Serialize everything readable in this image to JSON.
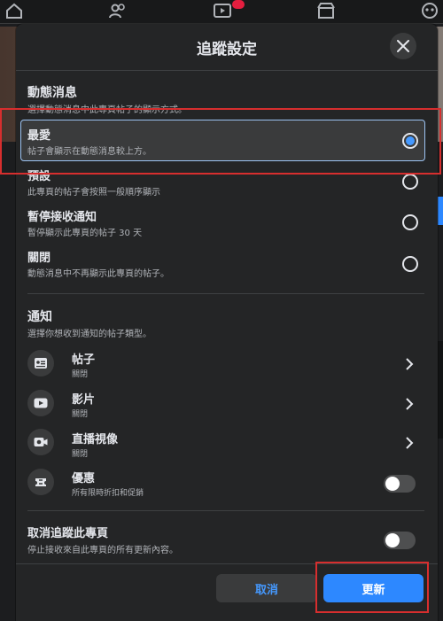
{
  "modal": {
    "title": "追蹤設定",
    "feed": {
      "title": "動態消息",
      "subtitle": "選擇動態消息中此專頁帖子的顯示方式。",
      "options": [
        {
          "label": "最愛",
          "description": "帖子會顯示在動態消息較上方。",
          "selected": true
        },
        {
          "label": "預設",
          "description": "此專頁的帖子會按照一般順序顯示",
          "selected": false
        },
        {
          "label": "暫停接收通知",
          "description": "暫停顯示此專頁的帖子 30 天",
          "selected": false
        },
        {
          "label": "關閉",
          "description": "動態消息中不再顯示此專頁的帖子。",
          "selected": false
        }
      ]
    },
    "notifications": {
      "title": "通知",
      "subtitle": "選擇你想收到通知的帖子類型。",
      "items": [
        {
          "label": "帖子",
          "status": "關閉",
          "icon": "post-icon",
          "control": "chevron"
        },
        {
          "label": "影片",
          "status": "關閉",
          "icon": "video-icon",
          "control": "chevron"
        },
        {
          "label": "直播視像",
          "status": "關閉",
          "icon": "live-video-icon",
          "control": "chevron"
        },
        {
          "label": "優惠",
          "status": "所有限時折扣和促銷",
          "icon": "offer-icon",
          "control": "toggle",
          "on": false
        }
      ]
    },
    "unfollow": {
      "title": "取消追蹤此專頁",
      "subtitle": "停止接收來自此專頁的所有更新內容。",
      "on": false
    },
    "buttons": {
      "cancel": "取消",
      "update": "更新"
    }
  },
  "colors": {
    "accent": "#2d88ff",
    "radio_selected": "#4599ff",
    "highlight": "#d72e2e",
    "background": "#242526"
  }
}
